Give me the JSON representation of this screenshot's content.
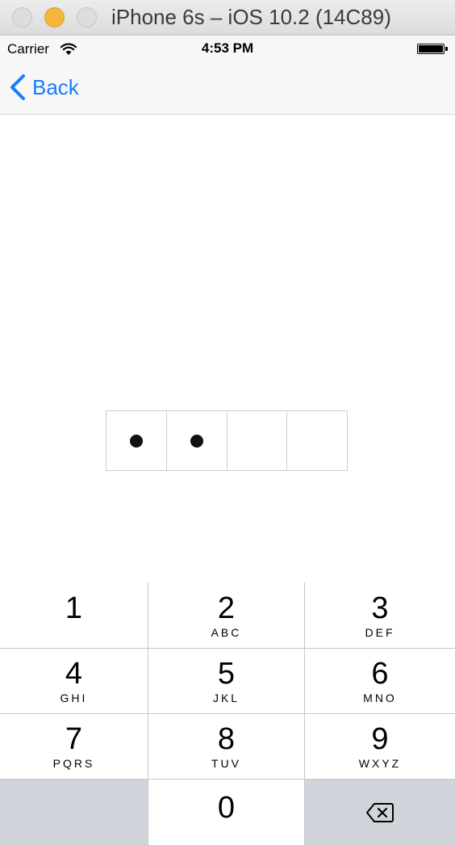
{
  "window": {
    "title": "iPhone 6s – iOS 10.2 (14C89)"
  },
  "status_bar": {
    "carrier": "Carrier",
    "time": "4:53 PM",
    "battery_level": 1.0
  },
  "nav": {
    "back_label": "Back"
  },
  "pin": {
    "length": 4,
    "filled": 2
  },
  "keypad": {
    "keys": [
      {
        "number": "1",
        "letters": ""
      },
      {
        "number": "2",
        "letters": "ABC"
      },
      {
        "number": "3",
        "letters": "DEF"
      },
      {
        "number": "4",
        "letters": "GHI"
      },
      {
        "number": "5",
        "letters": "JKL"
      },
      {
        "number": "6",
        "letters": "MNO"
      },
      {
        "number": "7",
        "letters": "PQRS"
      },
      {
        "number": "8",
        "letters": "TUV"
      },
      {
        "number": "9",
        "letters": "WXYZ"
      },
      {
        "number": "0",
        "letters": ""
      }
    ]
  },
  "colors": {
    "tint": "#147efb",
    "keypad_gray": "#d1d5db"
  }
}
